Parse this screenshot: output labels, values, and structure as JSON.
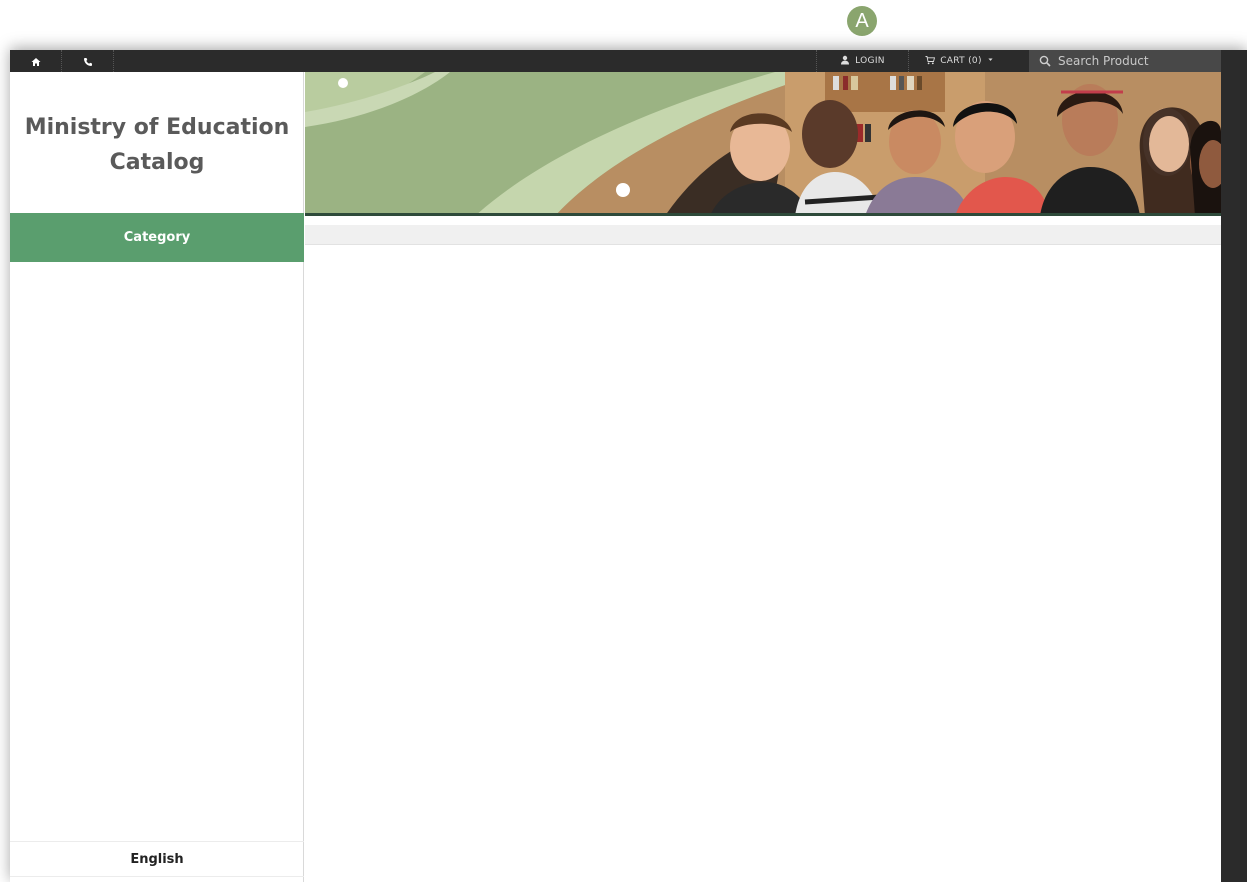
{
  "annotation": {
    "marker_label": "A"
  },
  "topbar": {
    "home_icon": "home-icon",
    "phone_icon": "phone-icon",
    "login_label": "LOGIN",
    "cart_label": "CART (0)",
    "search_placeholder": "Search Product"
  },
  "sidebar": {
    "title_line1": "Ministry of Education",
    "title_line2": "Catalog",
    "category_label": "Category",
    "language_label": "English"
  },
  "colors": {
    "topbar": "#2b2b2b",
    "accent_green": "#5a9e6e",
    "banner_green": "#9bb383"
  }
}
